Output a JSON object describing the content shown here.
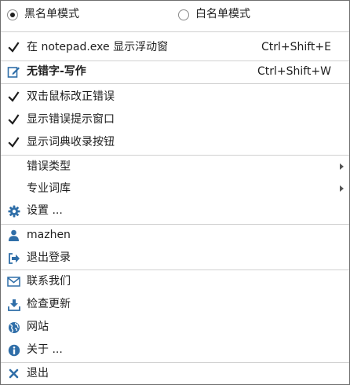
{
  "mode": {
    "blacklist_label": "黑名单模式",
    "blacklist_selected": true,
    "whitelist_label": "白名单模式",
    "whitelist_selected": false
  },
  "menu": {
    "float_window": {
      "label": "在 notepad.exe 显示浮动窗",
      "shortcut": "Ctrl+Shift+E",
      "checked": true,
      "icon": "check-icon"
    },
    "write": {
      "label": "无错字-写作",
      "shortcut": "Ctrl+Shift+W",
      "icon": "edit-icon"
    },
    "double_click": {
      "label": "双击鼠标改正错误",
      "checked": true,
      "icon": "check-icon"
    },
    "error_popup": {
      "label": "显示错误提示窗口",
      "checked": true,
      "icon": "check-icon"
    },
    "dict_button": {
      "label": "显示词典收录按钮",
      "checked": true,
      "icon": "check-icon"
    },
    "error_types": {
      "label": "错误类型",
      "icon": "submenu-arrow"
    },
    "pro_dict": {
      "label": "专业词库",
      "icon": "submenu-arrow"
    },
    "settings": {
      "label": "设置 ...",
      "icon": "gear-icon"
    },
    "user": {
      "label": "mazhen",
      "icon": "user-icon"
    },
    "logout": {
      "label": "退出登录",
      "icon": "logout-icon"
    },
    "contact": {
      "label": "联系我们",
      "icon": "envelope-icon"
    },
    "update": {
      "label": "检查更新",
      "icon": "download-icon"
    },
    "website": {
      "label": "网站",
      "icon": "globe-icon"
    },
    "about": {
      "label": "关于 ...",
      "icon": "info-icon"
    },
    "exit": {
      "label": "退出",
      "icon": "close-icon"
    }
  },
  "colors": {
    "icon_blue": "#2f6ea8",
    "check": "#1e1e1e",
    "separator": "#d0d0d0",
    "border": "#6e6e6e"
  }
}
